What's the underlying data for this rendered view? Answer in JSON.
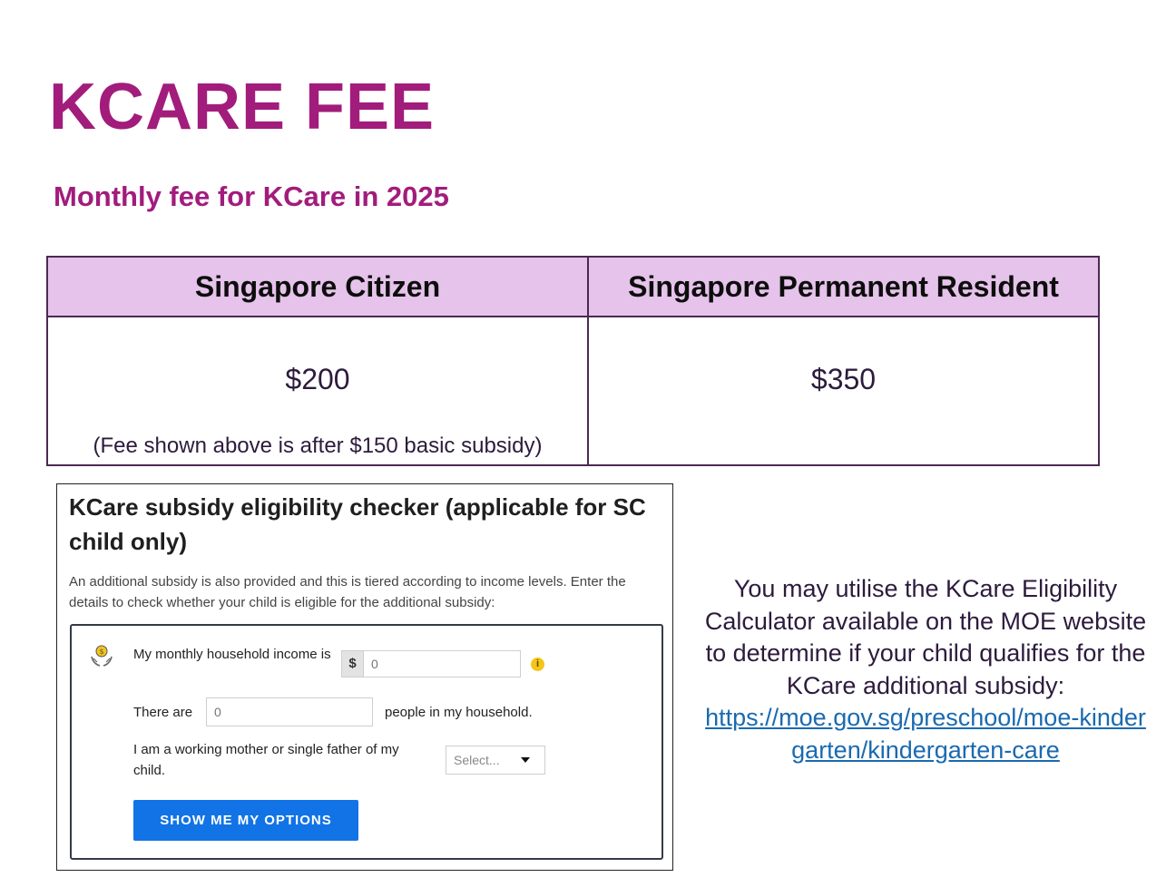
{
  "title": "KCARE FEE",
  "subtitle": "Monthly fee for KCare in 2025",
  "fee_table": {
    "headers": [
      "Singapore Citizen",
      "Singapore Permanent Resident"
    ],
    "citizen_fee": "$200",
    "citizen_note": "(Fee shown above is after $150 basic subsidy)",
    "pr_fee": "$350"
  },
  "checker": {
    "title": "KCare subsidy eligibility checker (applicable for SC child only)",
    "description": "An additional subsidy is also provided and this is tiered according to income levels. Enter the details to check whether your child is eligible for the additional subsidy:",
    "income_label": "My monthly household income is",
    "currency": "$",
    "income_placeholder": "0",
    "info_icon": "i",
    "there_are_label": "There are",
    "people_placeholder": "0",
    "people_label": "people in my household.",
    "mother_label": "I am a working mother or single father of my child.",
    "select_value": "Select...",
    "button_label": "SHOW ME MY OPTIONS",
    "icons": {
      "money": "money-hands-icon",
      "info": "info-icon",
      "caret": "chevron-down-icon"
    },
    "colors": {
      "button": "#1273e6",
      "info": "#f5c518"
    }
  },
  "side_note": {
    "text": "You may utilise the KCare Eligibility Calculator available on the MOE website to determine if your child qualifies for the KCare additional subsidy:",
    "link": "https://moe.gov.sg/preschool/moe-kindergarten/kindergarten-care"
  },
  "colors": {
    "accent": "#a21c7c",
    "header_bg": "#e5c3ea",
    "link": "#1a6ab0"
  }
}
